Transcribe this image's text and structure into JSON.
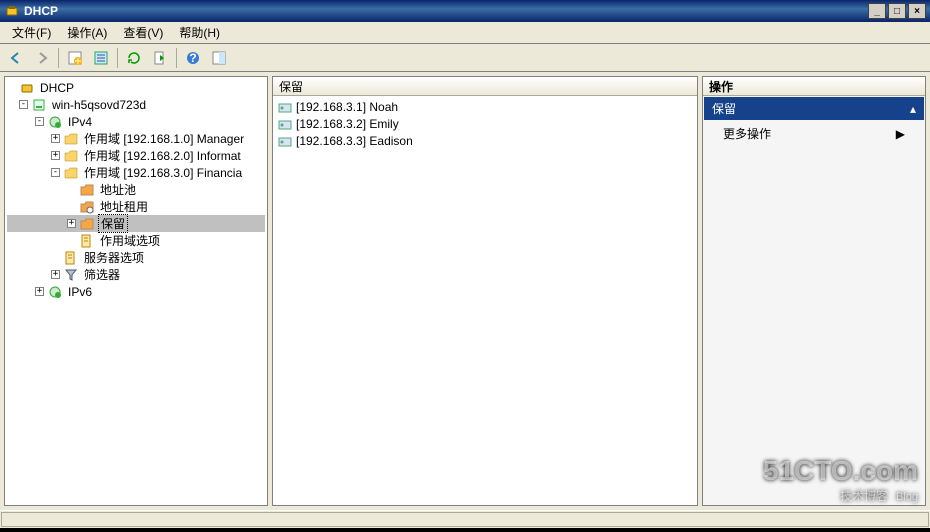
{
  "window": {
    "title": "DHCP"
  },
  "menu": {
    "file": "文件(F)",
    "ops": "操作(A)",
    "view": "查看(V)",
    "help": "帮助(H)"
  },
  "root_label": "DHCP",
  "server_label": "win-h5qsovd723d",
  "ipv4_label": "IPv4",
  "ipv6_label": "IPv6",
  "scope_prefix": "作用域",
  "scope1": "[192.168.1.0] Manager",
  "scope2": "[192.168.2.0] Informat",
  "scope3": "[192.168.3.0] Financia",
  "address_pool": "地址池",
  "leases": "地址租用",
  "reservations": "保留",
  "scope_options": "作用域选项",
  "server_options": "服务器选项",
  "filters": "筛选器",
  "list": {
    "header": "保留",
    "rows": [
      "[192.168.3.1] Noah",
      "[192.168.3.2] Emily",
      "[192.168.3.3] Eadison"
    ]
  },
  "actions": {
    "header": "操作",
    "category": "保留",
    "more": "更多操作"
  },
  "watermark": {
    "big": "51CTO.com",
    "small": "技术博客",
    "blog": "Blog"
  }
}
